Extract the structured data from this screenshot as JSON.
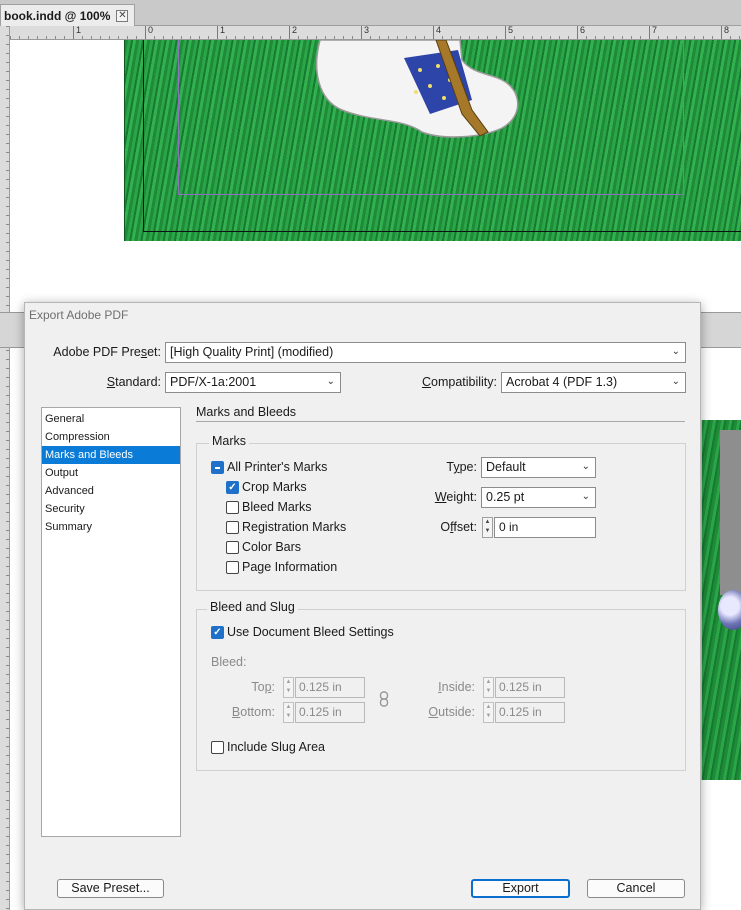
{
  "document_tab": {
    "title": "book.indd @ 100%",
    "close_glyph": "✕"
  },
  "ruler": {
    "labels": [
      "1",
      "0",
      "1",
      "2",
      "3",
      "4",
      "5",
      "6",
      "7",
      "8"
    ]
  },
  "dialog": {
    "title": "Export Adobe PDF",
    "preset": {
      "label_pre": "Adobe PDF Pre",
      "label_key": "s",
      "label_post": "et:",
      "value": "[High Quality Print] (modified)"
    },
    "standard": {
      "label_pre": "",
      "label_key": "S",
      "label_post": "tandard:",
      "value": "PDF/X-1a:2001"
    },
    "compatibility": {
      "label_pre": "",
      "label_key": "C",
      "label_post": "ompatibility:",
      "value": "Acrobat 4 (PDF 1.3)"
    },
    "sidebar": {
      "items": [
        {
          "label": "General"
        },
        {
          "label": "Compression"
        },
        {
          "label": "Marks and Bleeds"
        },
        {
          "label": "Output"
        },
        {
          "label": "Advanced"
        },
        {
          "label": "Security"
        },
        {
          "label": "Summary"
        }
      ],
      "active_index": 2
    },
    "section_title": "Marks and Bleeds",
    "marks": {
      "group_title": "Marks",
      "all_printers_marks": {
        "label": "All Printer's Marks",
        "state": "mixed"
      },
      "crop_marks": {
        "label": "Crop Marks",
        "checked": true
      },
      "bleed_marks": {
        "label": "Bleed Marks",
        "checked": false
      },
      "registration_marks": {
        "label": "Registration Marks",
        "checked": false
      },
      "color_bars": {
        "label": "Color Bars",
        "checked": false
      },
      "page_information": {
        "label": "Page Information",
        "checked": false
      },
      "type": {
        "label_pre": "T",
        "label_key": "y",
        "label_post": "pe:",
        "value": "Default"
      },
      "weight": {
        "label_pre": "",
        "label_key": "W",
        "label_post": "eight:",
        "value": "0.25 pt"
      },
      "offset": {
        "label_pre": "O",
        "label_key": "f",
        "label_post": "fset:",
        "value": "0 in"
      }
    },
    "bleed_and_slug": {
      "group_title": "Bleed and Slug",
      "use_document_bleed": {
        "label": "Use Document Bleed Settings",
        "checked": true
      },
      "bleed_label": "Bleed:",
      "top": {
        "label_pre": "To",
        "label_key": "p",
        "label_post": ":",
        "value": "0.125 in"
      },
      "bottom": {
        "label_pre": "",
        "label_key": "B",
        "label_post": "ottom:",
        "value": "0.125 in"
      },
      "inside": {
        "label_pre": "",
        "label_key": "I",
        "label_post": "nside:",
        "value": "0.125 in"
      },
      "outside": {
        "label_pre": "",
        "label_key": "O",
        "label_post": "utside:",
        "value": "0.125 in"
      },
      "include_slug": {
        "label": "Include Slug Area",
        "checked": false
      }
    },
    "buttons": {
      "save_preset": "Save Preset...",
      "export": "Export",
      "cancel": "Cancel"
    },
    "icons": {
      "chevron": "chevron-down-icon",
      "check": "checkmark-icon",
      "link": "chain-link-icon"
    }
  }
}
